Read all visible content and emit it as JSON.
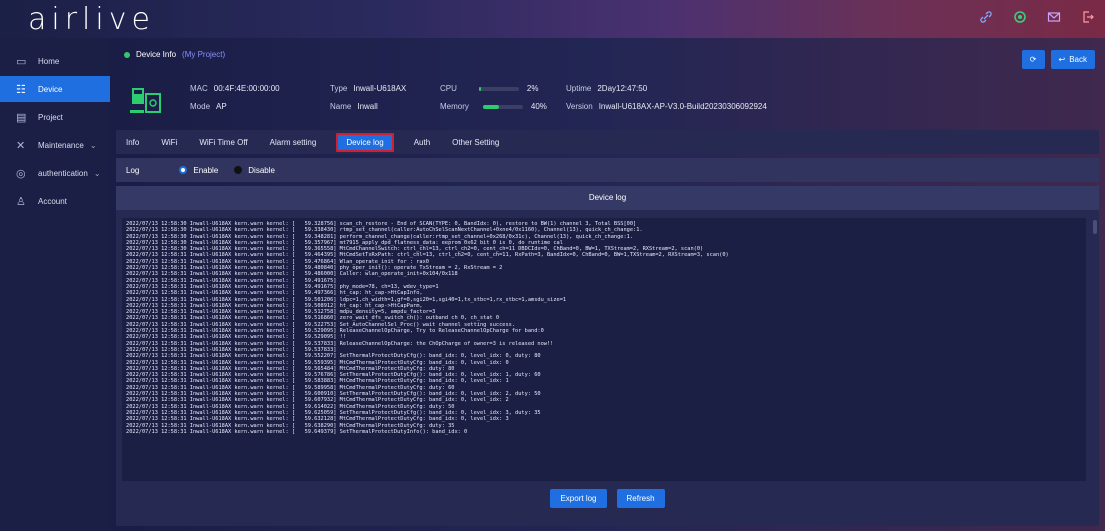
{
  "brand": {
    "logo": "airlive"
  },
  "colors": {
    "accent": "#1f6fe0",
    "online": "#35c86a",
    "highlight_border": "#d02030"
  },
  "top_icons": [
    "link-icon",
    "settings-icon",
    "mail-icon",
    "logout-icon"
  ],
  "sidebar": {
    "items": [
      {
        "label": "Home",
        "icon": "monitor-icon"
      },
      {
        "label": "Device",
        "icon": "device-list-icon"
      },
      {
        "label": "Project",
        "icon": "project-icon"
      },
      {
        "label": "Maintenance",
        "icon": "tools-icon"
      },
      {
        "label": "authentication",
        "icon": "check-circle-icon"
      },
      {
        "label": "Account",
        "icon": "users-icon"
      }
    ]
  },
  "header": {
    "title": "Device Info",
    "project": "(My Project)",
    "refresh_label": "⟳",
    "back_label": "Back"
  },
  "device": {
    "mac_label": "MAC",
    "mac": "00:4F:4E:00:00:00",
    "mode_label": "Mode",
    "mode": "AP",
    "type_label": "Type",
    "type": "Inwall-U618AX",
    "name_label": "Name",
    "name": "Inwall",
    "cpu_label": "CPU",
    "cpu": "2%",
    "cpu_value": 0.02,
    "memory_label": "Memory",
    "memory": "40%",
    "memory_value": 0.4,
    "uptime_label": "Uptime",
    "uptime": "2Day12:47:50",
    "version_label": "Version",
    "version": "Inwall-U618AX-AP-V3.0-Build20230306092924"
  },
  "tabs": [
    "Info",
    "WiFi",
    "WiFi Time Off",
    "Alarm setting",
    "Device log",
    "Auth",
    "Other Setting"
  ],
  "log_setting": {
    "label": "Log",
    "enable": "Enable",
    "disable": "Disable"
  },
  "panel": {
    "title": "Device log"
  },
  "log_lines": [
    "2022/07/13 12:58:30 Inwall-U618AX kern.warn kernel: [   59.328756] scan_ch_restore - End of SCAN(TYPE: 0, BandIdx: 0), restore to BW(1) channel 3, Total BSS[00]",
    "2022/07/13 12:58:30 Inwall-U618AX kern.warn kernel: [   59.338430] rtmp_set_channel(caller:AutoChSelScanNextChannel+0xne4/0x1160), Channel(13), quick_ch_change:1.",
    "2022/07/13 12:58:30 Inwall-U618AX kern.warn kernel: [   59.348281] perform_channel_change(caller:rtmp_set_channel+0x268/0x31c), Channel(13), quick_ch_change:1.",
    "2022/07/13 12:58:30 Inwall-U618AX kern.warn kernel: [   59.357967] mt7915_apply_dpd_flatness_data: eeprom 0x62 bit 0 is 0, do runtime cal",
    "2022/07/13 12:58:30 Inwall-U618AX kern.warn kernel: [   59.365558] MtCmdChannelSwitch: ctrl_chl=13, ctrl_ch2=0, cent_ch=11 DBDCIdx=0, ChBand=0, BW=1, TXStream=2, RXStream=2, scan(0)",
    "2022/07/13 12:58:31 Inwall-U618AX kern.warn kernel: [   59.464395] MtCmdSetTxRxPath: ctrl_chl=13, ctrl_ch2=0, cent_ch=11, RxPath=3, BandIdx=0, ChBand=0, BW=1,TXStream=2, RXStream=3, scan(0)",
    "2022/07/13 12:58:31 Inwall-U618AX kern.warn kernel: [   59.476864] Wlan_operate_init for : rax0",
    "2022/07/13 12:58:31 Inwall-U618AX kern.warn kernel: [   59.480840] phy_oper_init(): operate TxStream = 2, RxStream = 2",
    "2022/07/13 12:58:31 Inwall-U618AX kern.warn kernel: [   59.486000] Caller: wlan_operate_init+0x104/0x118",
    "2022/07/13 12:58:31 Inwall-U618AX kern.warn kernel: [   59.491675]",
    "2022/07/13 12:58:31 Inwall-U618AX kern.warn kernel: [   59.491675] phy_mode=78, ch=13, wdev_type=1",
    "2022/07/13 12:58:31 Inwall-U618AX kern.warn kernel: [   59.497366] ht_cap: ht_cap->HtCapInfo,",
    "2022/07/13 12:58:31 Inwall-U618AX kern.warn kernel: [   59.501206] ldpc=1,ch_width=1,gf=0,sgi20=1,sgi40=1,tx_stbc=1,rx_stbc=1,amsdu_size=1",
    "2022/07/13 12:58:31 Inwall-U618AX kern.warn kernel: [   59.508912] ht_cap: ht_cap->HtCapParm,",
    "2022/07/13 12:58:31 Inwall-U618AX kern.warn kernel: [   59.512758] mdpu_density=5, ampdu_factor=3",
    "2022/07/13 12:58:31 Inwall-U618AX kern.warn kernel: [   59.516860] zero_wait_dfs_switch_ch(): outband ch 0, ch_stat 0",
    "2022/07/13 12:58:31 Inwall-U618AX kern.warn kernel: [   59.522753] Set_AutoChannelSel_Proc() wait channel setting success.",
    "2022/07/13 12:58:31 Inwall-U618AX kern.warn kernel: [   59.529095] ReleaseChannelOpCharge, Try to ReleaseChannelOpCharge for band:0",
    "2022/07/13 12:58:31 Inwall-U618AX kern.warn kernel: [   59.529095] !!",
    "2022/07/13 12:58:31 Inwall-U618AX kern.warn kernel: [   59.537833] ReleaseChannelOpCharge: the ChOpCharge of owner=3 is released now!!",
    "2022/07/13 12:58:31 Inwall-U618AX kern.warn kernel: [   59.537833]",
    "2022/07/13 12:58:31 Inwall-U618AX kern.warn kernel: [   59.552207] SetThermalProtectDutyCfg(): band_idx: 0, level_idx: 0, duty: 80",
    "2022/07/13 12:58:31 Inwall-U618AX kern.warn kernel: [   59.559395] MtCmdThermalProtectDutyCfg: band_idx: 0, level_idx: 0",
    "2022/07/13 12:58:31 Inwall-U618AX kern.warn kernel: [   59.565484] MtCmdThermalProtectDutyCfg: duty: 80",
    "2022/07/13 12:58:31 Inwall-U618AX kern.warn kernel: [   59.576786] SetThermalProtectDutyCfg(): band_idx: 0, level_idx: 1, duty: 60",
    "2022/07/13 12:58:31 Inwall-U618AX kern.warn kernel: [   59.583883] MtCmdThermalProtectDutyCfg: band_idx: 0, level_idx: 1",
    "2022/07/13 12:58:31 Inwall-U618AX kern.warn kernel: [   59.589958] MtCmdThermalProtectDutyCfg: duty: 60",
    "2022/07/13 12:58:31 Inwall-U618AX kern.warn kernel: [   59.600910] SetThermalProtectDutyCfg(): band_idx: 0, level_idx: 2, duty: 50",
    "2022/07/13 12:58:31 Inwall-U618AX kern.warn kernel: [   59.607932] MtCmdThermalProtectDutyCfg: band_idx: 0, level_idx: 2",
    "2022/07/13 12:58:31 Inwall-U618AX kern.warn kernel: [   59.614022] MtCmdThermalProtectDutyCfg: duty: 50",
    "2022/07/13 12:58:31 Inwall-U618AX kern.warn kernel: [   59.625059] SetThermalProtectDutyCfg(): band_idx: 0, level_idx: 3, duty: 35",
    "2022/07/13 12:58:31 Inwall-U618AX kern.warn kernel: [   59.632128] MtCmdThermalProtectDutyCfg: band_idx: 0, level_idx: 3",
    "2022/07/13 12:58:31 Inwall-U618AX kern.warn kernel: [   59.638290] MtCmdThermalProtectDutyCfg: duty: 35",
    "2022/07/13 12:58:31 Inwall-U618AX kern.warn kernel: [   59.649379] SetThermalProtectDutyInfo(): band_idx: 0"
  ],
  "footer": {
    "export": "Export log",
    "refresh": "Refresh"
  }
}
